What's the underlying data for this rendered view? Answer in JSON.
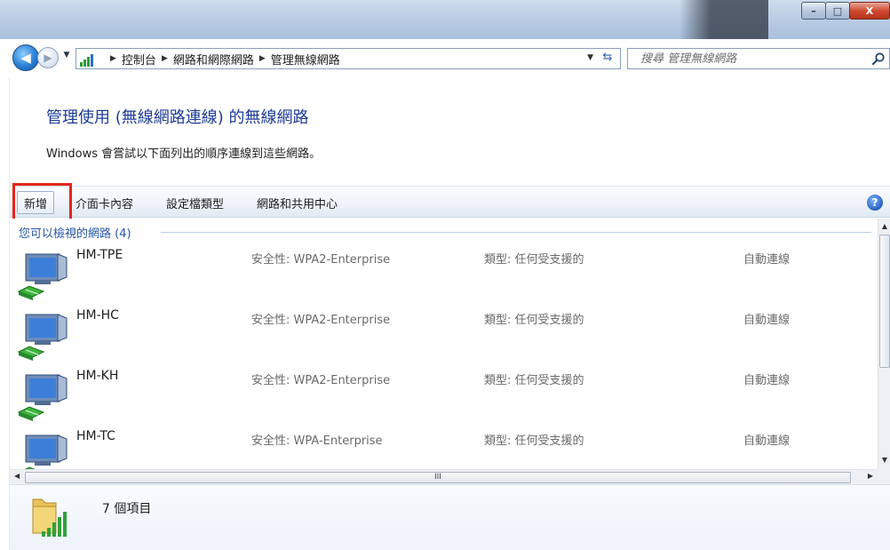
{
  "window": {
    "controls": {
      "minimize": "–",
      "maximize": "□",
      "close": "X"
    }
  },
  "address_bar": {
    "back_icon": "back-arrow-icon",
    "forward_icon": "forward-arrow-icon",
    "breadcrumbs": [
      "控制台",
      "網路和網際網路",
      "管理無線網路"
    ],
    "search_placeholder": "搜尋 管理無線網路"
  },
  "header": {
    "title": "管理使用 (無線網路連線) 的無線網路",
    "description": "Windows 會嘗試以下面列出的順序連線到這些網路。"
  },
  "toolbar": {
    "items": [
      "新增",
      "介面卡內容",
      "設定檔類型",
      "網路和共用中心"
    ],
    "help_label": "?"
  },
  "list": {
    "group_header": "您可以檢視的網路 (4)",
    "networks": [
      {
        "name": "HM-TPE",
        "security": "安全性: WPA2-Enterprise",
        "type": "類型: 任何受支援的",
        "mode": "自動連線"
      },
      {
        "name": "HM-HC",
        "security": "安全性: WPA2-Enterprise",
        "type": "類型: 任何受支援的",
        "mode": "自動連線"
      },
      {
        "name": "HM-KH",
        "security": "安全性: WPA2-Enterprise",
        "type": "類型: 任何受支援的",
        "mode": "自動連線"
      },
      {
        "name": "HM-TC",
        "security": "安全性: WPA-Enterprise",
        "type": "類型: 任何受支援的",
        "mode": "自動連線"
      }
    ],
    "hscroll_grip": "III"
  },
  "details": {
    "item_count": "7 個項目"
  },
  "colors": {
    "title_blue": "#1e3c96",
    "group_blue": "#2556a5",
    "highlight_red": "#e3261b"
  }
}
